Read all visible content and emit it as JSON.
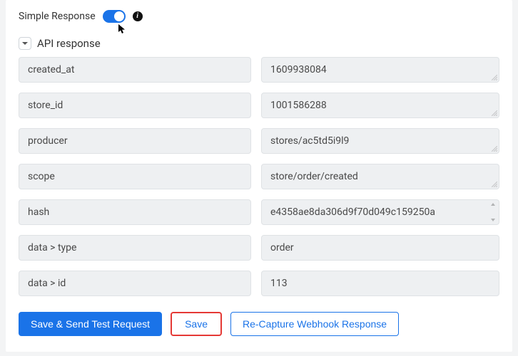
{
  "header": {
    "simple_response_label": "Simple Response",
    "toggle_on": true
  },
  "section": {
    "title": "API response"
  },
  "rows": [
    {
      "key": "created_at",
      "value": "1609938084"
    },
    {
      "key": "store_id",
      "value": "1001586288"
    },
    {
      "key": "producer",
      "value": "stores/ac5td5i9l9"
    },
    {
      "key": "scope",
      "value": "store/order/created"
    },
    {
      "key": "hash",
      "value": "e4358ae8da306d9f70d049c159250a",
      "scrollable": true
    },
    {
      "key": "data > type",
      "value": "order"
    },
    {
      "key": "data > id",
      "value": "113"
    }
  ],
  "buttons": {
    "save_send": "Save & Send Test Request",
    "save": "Save",
    "recapture": "Re-Capture Webhook Response"
  }
}
